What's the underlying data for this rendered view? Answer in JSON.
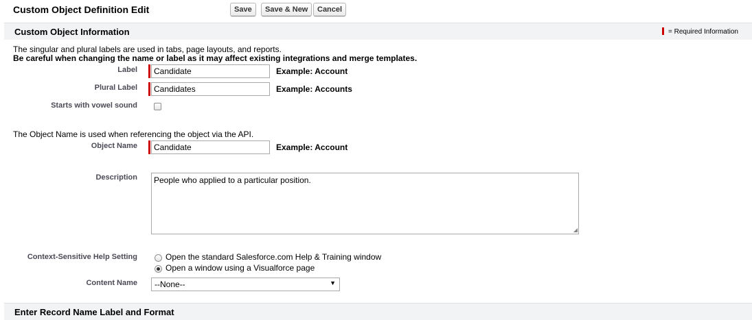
{
  "header": {
    "title": "Custom Object Definition Edit",
    "save_label": "Save",
    "save_new_label": "Save & New",
    "cancel_label": "Cancel"
  },
  "section1": {
    "title": "Custom Object Information",
    "required_legend": "= Required Information",
    "intro_line1": "The singular and plural labels are used in tabs, page layouts, and reports.",
    "intro_line2": "Be careful when changing the name or label as it may affect existing integrations and merge templates.",
    "label_field": {
      "label": "Label",
      "value": "Candidate",
      "example": "Example:  Account"
    },
    "plural_field": {
      "label": "Plural Label",
      "value": "Candidates",
      "example": "Example:  Accounts"
    },
    "vowel_field": {
      "label": "Starts with vowel sound",
      "checked": false
    },
    "api_note": "The Object Name is used when referencing the object via the API.",
    "object_name_field": {
      "label": "Object Name",
      "value": "Candidate",
      "example": "Example:  Account"
    },
    "description_field": {
      "label": "Description",
      "value": "People who applied to a particular position."
    },
    "help_setting": {
      "label": "Context-Sensitive Help Setting",
      "options": [
        {
          "label": "Open the standard Salesforce.com Help & Training window",
          "selected": false
        },
        {
          "label": "Open a window using a Visualforce page",
          "selected": true
        }
      ]
    },
    "content_name": {
      "label": "Content Name",
      "selected": "--None--"
    }
  },
  "section2": {
    "title": "Enter Record Name Label and Format"
  },
  "colors": {
    "required": "#cc0000",
    "section_bg": "#f2f3f5",
    "label_text": "#4a4a56"
  }
}
